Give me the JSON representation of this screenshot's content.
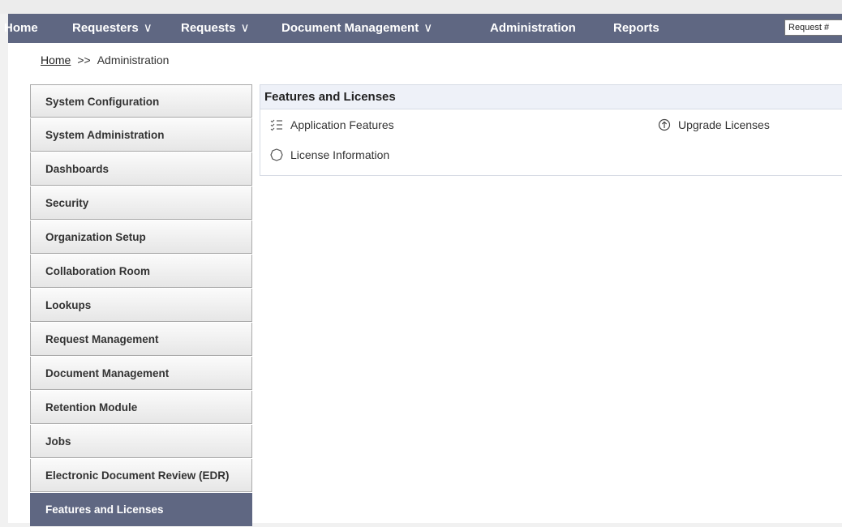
{
  "navbar": {
    "home": "Home",
    "requesters": "Requesters",
    "requests": "Requests",
    "document_management": "Document Management",
    "administration": "Administration",
    "reports": "Reports",
    "chevron": "∨",
    "search_placeholder": "Request #",
    "background_color": "#5f6782"
  },
  "breadcrumb": {
    "home": "Home",
    "separator": ">>",
    "current": "Administration"
  },
  "sidebar": {
    "items": [
      {
        "label": "System Configuration"
      },
      {
        "label": "System Administration"
      },
      {
        "label": "Dashboards"
      },
      {
        "label": "Security"
      },
      {
        "label": "Organization Setup"
      },
      {
        "label": "Collaboration Room"
      },
      {
        "label": "Lookups"
      },
      {
        "label": "Request Management"
      },
      {
        "label": "Document Management"
      },
      {
        "label": "Retention Module"
      },
      {
        "label": "Jobs"
      },
      {
        "label": "Electronic Document Review (EDR)"
      },
      {
        "label": "Features and Licenses",
        "active": true
      }
    ]
  },
  "panel": {
    "title": "Features and Licenses",
    "links": {
      "application_features": {
        "label": "Application Features",
        "icon": "checklist-icon"
      },
      "upgrade_licenses": {
        "label": "Upgrade Licenses",
        "icon": "arrow-up-circle-icon"
      },
      "license_information": {
        "label": "License Information",
        "icon": "badge-icon"
      }
    }
  }
}
